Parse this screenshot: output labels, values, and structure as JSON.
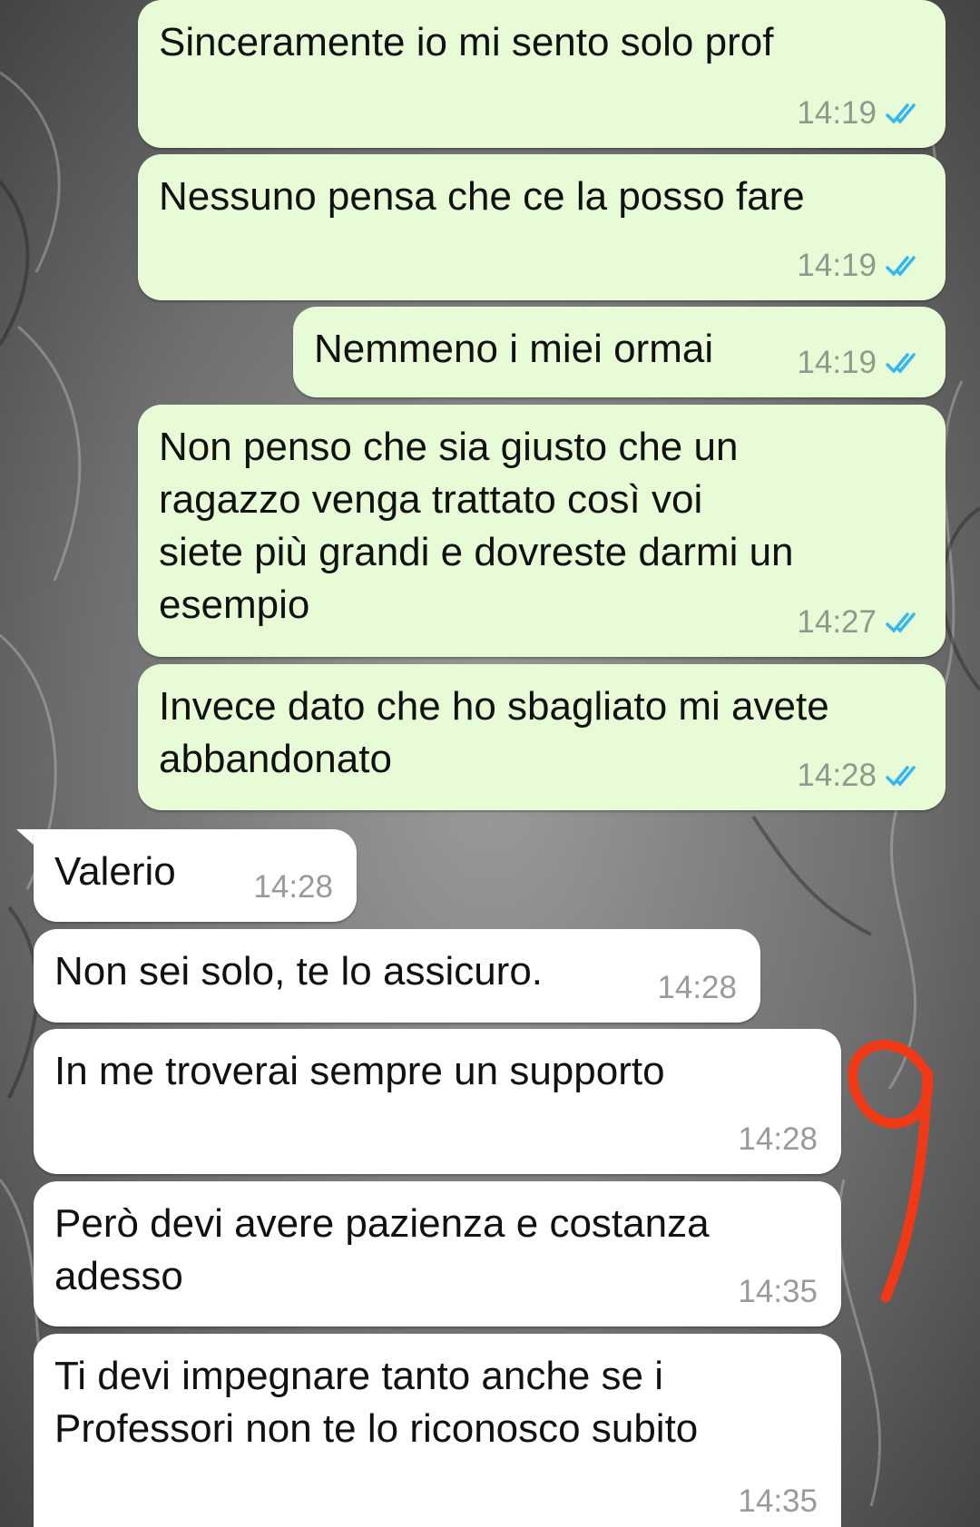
{
  "accent": {
    "outgoing_bubble": "#e7fcd6",
    "incoming_bubble": "#ffffff",
    "read_ticks": "#34b7f1"
  },
  "messages": [
    {
      "text_lines": [
        "Sinceramente io mi sento solo prof"
      ],
      "time": "14:19",
      "direction": "outgoing",
      "status": "read"
    },
    {
      "text_lines": [
        "Nessuno pensa che ce la posso fare"
      ],
      "time": "14:19",
      "direction": "outgoing",
      "status": "read"
    },
    {
      "text_lines": [
        "Nemmeno i miei ormai"
      ],
      "time": "14:19",
      "direction": "outgoing",
      "status": "read"
    },
    {
      "text_lines": [
        "Non penso che sia giusto che un",
        "ragazzo venga trattato così voi",
        "siete più grandi e dovreste darmi un",
        "esempio"
      ],
      "time": "14:27",
      "direction": "outgoing",
      "status": "read"
    },
    {
      "text_lines": [
        "Invece dato che ho sbagliato mi avete",
        "abbandonato"
      ],
      "time": "14:28",
      "direction": "outgoing",
      "status": "read"
    },
    {
      "text_lines": [
        "Valerio"
      ],
      "time": "14:28",
      "direction": "incoming"
    },
    {
      "text_lines": [
        "Non sei solo, te lo assicuro."
      ],
      "time": "14:28",
      "direction": "incoming"
    },
    {
      "text_lines": [
        "In me troverai sempre un supporto"
      ],
      "time": "14:28",
      "direction": "incoming"
    },
    {
      "text_lines": [
        "Però devi avere pazienza e costanza",
        "adesso"
      ],
      "time": "14:35",
      "direction": "incoming"
    },
    {
      "text_lines": [
        "Ti devi impegnare tanto anche se i",
        "Professori non te lo riconosco subito"
      ],
      "time": "14:35",
      "direction": "incoming"
    }
  ],
  "annotation": {
    "color": "#f03a17"
  }
}
